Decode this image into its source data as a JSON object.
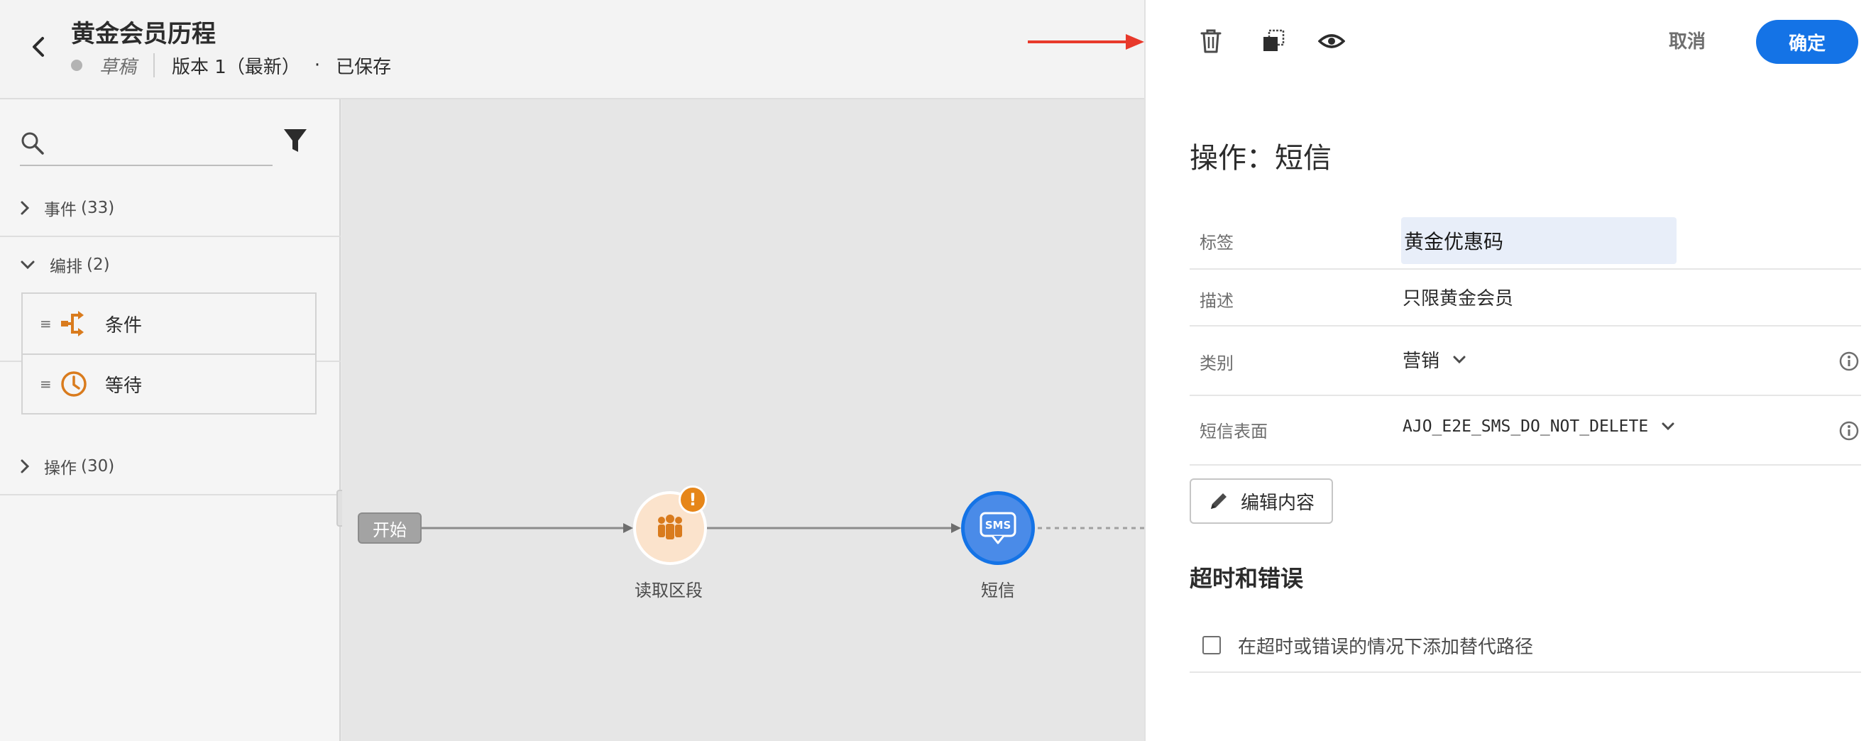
{
  "header": {
    "title": "黄金会员历程",
    "status": "草稿",
    "version": "版本 1（最新）",
    "separator": "·",
    "saved": "已保存"
  },
  "sidebar": {
    "search": {
      "placeholder": "",
      "value": ""
    },
    "groups": [
      {
        "label": "事件",
        "count": "(33)",
        "expanded": false
      },
      {
        "label": "编排",
        "count": "(2)",
        "expanded": true
      },
      {
        "label": "操作",
        "count": "(30)",
        "expanded": false
      }
    ],
    "orchestration_items": [
      {
        "label": "条件",
        "icon": "condition-icon",
        "handle": "≡"
      },
      {
        "label": "等待",
        "icon": "wait-clock-icon",
        "handle": "≡"
      }
    ]
  },
  "canvas": {
    "start_label": "开始",
    "nodes": [
      {
        "label": "读取区段",
        "icon": "audience-icon",
        "warning": "!"
      },
      {
        "label": "短信",
        "icon": "sms-icon",
        "icon_text": "SMS"
      }
    ]
  },
  "properties": {
    "toolbar": {
      "icons": [
        "trash-icon",
        "duplicate-icon",
        "preview-eye-icon"
      ],
      "cancel": "取消",
      "confirm": "确定"
    },
    "title": "操作：短信",
    "fields": {
      "label": {
        "name": "标签",
        "value": "黄金优惠码"
      },
      "description": {
        "name": "描述",
        "value": "只限黄金会员"
      },
      "category": {
        "name": "类别",
        "value": "营销"
      },
      "sms_surface": {
        "name": "短信表面",
        "value": "AJO_E2E_SMS_DO_NOT_DELETE"
      }
    },
    "edit_content": "编辑内容",
    "timeout_section": "超时和错误",
    "alt_path_checkbox": {
      "label": "在超时或错误的情况下添加替代路径",
      "checked": false
    }
  },
  "colors": {
    "accent_blue": "#1473e6",
    "annotation_arrow": "#e8392b",
    "warning_orange": "#e68619",
    "orchestration_orange": "#d97b1d"
  }
}
